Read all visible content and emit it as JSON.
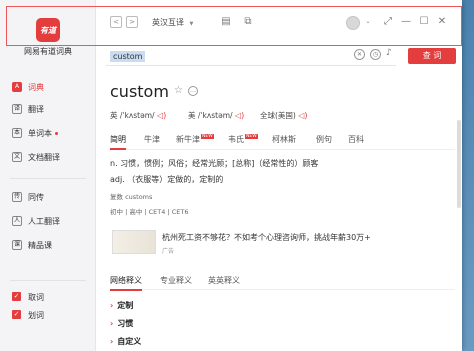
{
  "app": {
    "logo_text": "有道",
    "name": "网易有道词典"
  },
  "sidebar": {
    "items": [
      {
        "label": "词典",
        "icon": "A"
      },
      {
        "label": "翻译",
        "icon": "译"
      },
      {
        "label": "单词本",
        "icon": "本"
      },
      {
        "label": "文档翻译",
        "icon": "文"
      },
      {
        "label": "同传",
        "icon": "传"
      },
      {
        "label": "人工翻译",
        "icon": "人"
      },
      {
        "label": "精品课",
        "icon": "课"
      }
    ],
    "toggles": [
      {
        "label": "取词"
      },
      {
        "label": "划词"
      }
    ]
  },
  "toolbar": {
    "back": "<",
    "forward": ">",
    "mode": "英汉互译",
    "mode_chev": "▼"
  },
  "search": {
    "value": "custom",
    "button": "查 词"
  },
  "entry": {
    "word": "custom",
    "uk_label": "英 /ˈkʌstəm/",
    "us_label": "美 /ˈkʌstəm/",
    "global_label": "全球(美国)",
    "tabs": [
      {
        "label": "简明"
      },
      {
        "label": "牛津"
      },
      {
        "label": "新牛津",
        "badge": "NEW"
      },
      {
        "label": "韦氏",
        "badge": "NEW"
      },
      {
        "label": "柯林斯"
      },
      {
        "label": "例句"
      },
      {
        "label": "百科"
      }
    ],
    "def1": "n. 习惯，惯例；风俗；经常光顾；[总称]（经常性的）顾客",
    "def2": "adj. （衣服等）定做的，定制的",
    "plural": "复数 customs",
    "levels": "初中 | 高中 | CET4 | CET6"
  },
  "ad": {
    "text": "杭州死工资不够花？不如考个心理咨询师，挑战年薪30万+",
    "label": "广告"
  },
  "lower_tabs": [
    {
      "label": "网络释义"
    },
    {
      "label": "专业释义"
    },
    {
      "label": "英英释义"
    }
  ],
  "net_meanings": [
    {
      "label": "定制"
    },
    {
      "label": "习惯"
    },
    {
      "label": "自定义"
    }
  ],
  "colors": {
    "accent": "#e33d3d"
  }
}
